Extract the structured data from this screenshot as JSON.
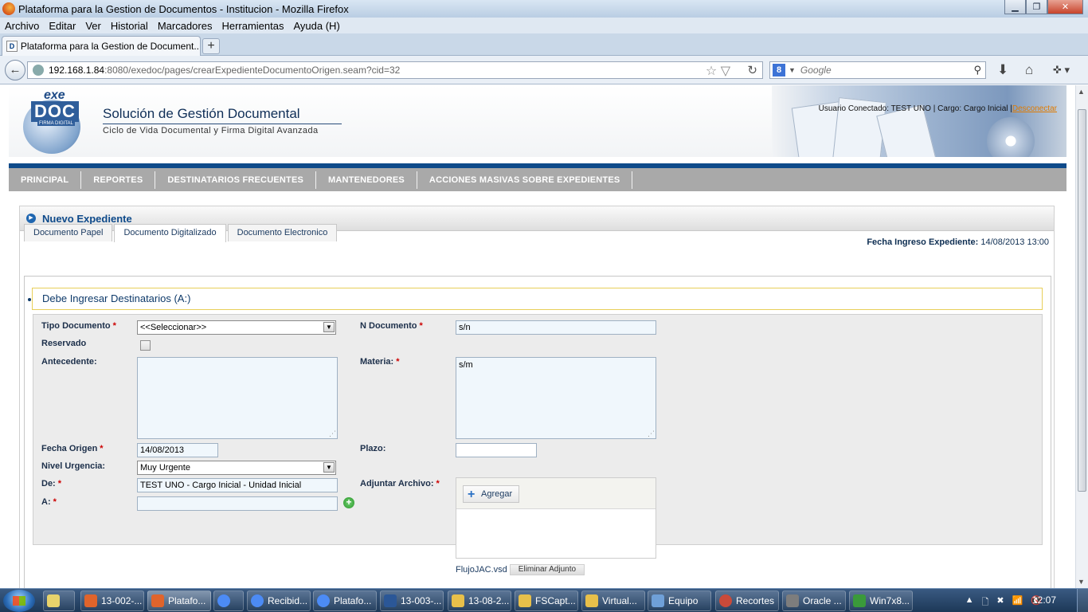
{
  "window": {
    "title": "Plataforma para la Gestion de Documentos - Institucion - Mozilla Firefox",
    "min": "▁",
    "max": "❐",
    "close": "✕"
  },
  "menu": [
    "Archivo",
    "Editar",
    "Ver",
    "Historial",
    "Marcadores",
    "Herramientas",
    "Ayuda (H)"
  ],
  "browser_tab": {
    "label": "Plataforma para la Gestion de Document...",
    "favicon": "D",
    "new_tab": "+"
  },
  "navbar": {
    "back": "←",
    "url_host": "192.168.1.84",
    "url_rest": ":8080/exedoc/pages/crearExpedienteDocumentoOrigen.seam?cid=32",
    "star": "☆ ▽",
    "reload": "↻",
    "search_engine": "8",
    "search_arrow": "▼",
    "search_placeholder": "Google",
    "search_icon": "⚲",
    "download": "⬇",
    "home": "⌂",
    "tools": "✜ ▾"
  },
  "header": {
    "logo_exe": "exe",
    "logo_doc": "DOC",
    "logo_firma": "FIRMA DIGITAL",
    "title": "Solución de Gestión Documental",
    "subtitle": "Ciclo de Vida Documental y Firma Digital Avanzada",
    "user_text": "Usuario Conectado: TEST UNO | Cargo: Cargo Inicial |",
    "logout": "Desconectar"
  },
  "nav": [
    "PRINCIPAL",
    "REPORTES",
    "DESTINATARIOS FRECUENTES",
    "MANTENEDORES",
    "ACCIONES MASIVAS SOBRE EXPEDIENTES"
  ],
  "panel": {
    "bullet": "▶",
    "title": "Nuevo Expediente",
    "fecha_label": "Fecha Ingreso Expediente:",
    "fecha_value": "14/08/2013 13:00"
  },
  "doc_tabs": [
    "Documento Papel",
    "Documento Digitalizado",
    "Documento Electronico"
  ],
  "warning": "Debe Ingresar Destinatarios (A:)",
  "form": {
    "required_mark": "*",
    "tipo_documento": {
      "label": "Tipo Documento",
      "value": "<<Seleccionar>>"
    },
    "reservado": {
      "label": "Reservado"
    },
    "antecedente": {
      "label": "Antecedente:",
      "value": ""
    },
    "fecha_origen": {
      "label": "Fecha Origen",
      "value": "14/08/2013"
    },
    "nivel_urgencia": {
      "label": "Nivel Urgencia:",
      "value": "Muy Urgente"
    },
    "de": {
      "label": "De:",
      "value": "TEST UNO - Cargo Inicial - Unidad Inicial"
    },
    "a": {
      "label": "A:",
      "value": ""
    },
    "n_documento": {
      "label": "N Documento",
      "value": "s/n"
    },
    "materia": {
      "label": "Materia:",
      "value": "s/m"
    },
    "plazo": {
      "label": "Plazo:",
      "value": ""
    },
    "adjuntar": {
      "label": "Adjuntar Archivo:",
      "add_button": "Agregar"
    },
    "file_name": "FlujoJAC.vsd",
    "remove_button": "Eliminar Adjunto",
    "select_arrow": "▼",
    "grip": "⋰",
    "add_icon": "+"
  },
  "taskbar": {
    "items": [
      {
        "label": "13-002-...",
        "color": "#e0642b"
      },
      {
        "label": "Platafo...",
        "color": "#e0642b"
      },
      {
        "label": "",
        "color": "#4c8bf5"
      },
      {
        "label": "Recibid...",
        "color": "#4c8bf5"
      },
      {
        "label": "Platafo...",
        "color": "#4c8bf5"
      },
      {
        "label": "13-003-...",
        "color": "#2b5797"
      },
      {
        "label": "13-08-2...",
        "color": "#e8c04a"
      },
      {
        "label": "FSCapt...",
        "color": "#e8c04a"
      },
      {
        "label": "Virtual...",
        "color": "#e8c04a"
      },
      {
        "label": "Equipo",
        "color": "#6fa0d8"
      },
      {
        "label": "Recortes",
        "color": "#c94a3a"
      },
      {
        "label": "Oracle ...",
        "color": "#7d7d7d"
      },
      {
        "label": "Win7x8...",
        "color": "#3a9a3a"
      }
    ],
    "tray": [
      "▲",
      "🗋",
      "✖",
      "📶",
      "🔇"
    ],
    "clock": "12:07"
  },
  "scrollbar": {
    "up": "▲",
    "down": "▼"
  }
}
